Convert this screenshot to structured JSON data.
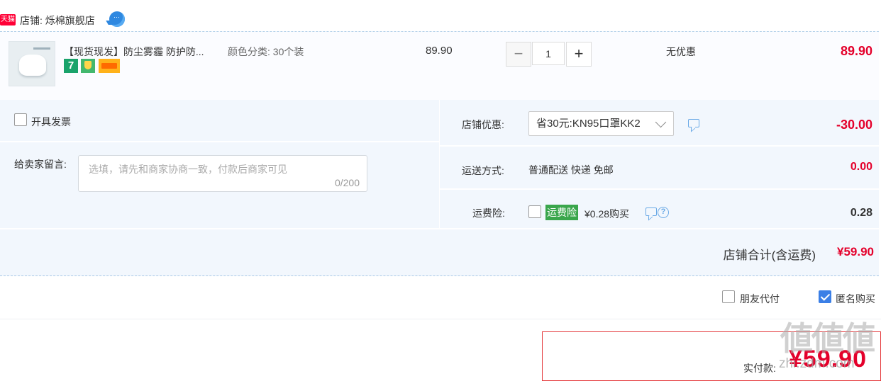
{
  "store": {
    "badge": "天猫",
    "name": "店铺: 烁棉旗舰店",
    "chat_icon": "chat-bubble-icon"
  },
  "item": {
    "title": "【现货现发】防尘雾霾 防护防...",
    "sku": "颜色分类: 30个装",
    "unit_price": "89.90",
    "quantity": "1",
    "minus": "−",
    "plus": "+",
    "discount": "无优惠",
    "subtotal": "89.90",
    "badges": [
      "7",
      "shield-badge-icon",
      "card-badge-icon"
    ]
  },
  "invoice": {
    "label": "开具发票",
    "checked": false
  },
  "message": {
    "label": "给卖家留言:",
    "placeholder": "选填，请先和商家协商一致，付款后商家可见",
    "counter": "0/200"
  },
  "store_discount": {
    "label": "店铺优惠:",
    "selected": "省30元:KN95口罩KK2",
    "amount": "-30.00"
  },
  "shipping": {
    "label": "运送方式:",
    "method": "普通配送 快递 免邮",
    "amount": "0.00"
  },
  "insurance": {
    "label": "运费险:",
    "tag": "运费险",
    "price": "¥0.28购买",
    "amount": "0.28"
  },
  "store_total": {
    "label": "店铺合计(含运费)",
    "amount": "¥59.90"
  },
  "options": {
    "friend_pay": "朋友代付",
    "anonymous": "匿名购买"
  },
  "payment": {
    "label": "实付款:",
    "amount": "¥59.90"
  },
  "watermark": {
    "text": "値値値",
    "url": "zhi.zdm.com"
  },
  "colors": {
    "price_red": "#e4002b",
    "panel_bg": "#f2f7fd",
    "checkbox_blue": "#3b7fe6",
    "insurance_green": "#3aa64c"
  }
}
